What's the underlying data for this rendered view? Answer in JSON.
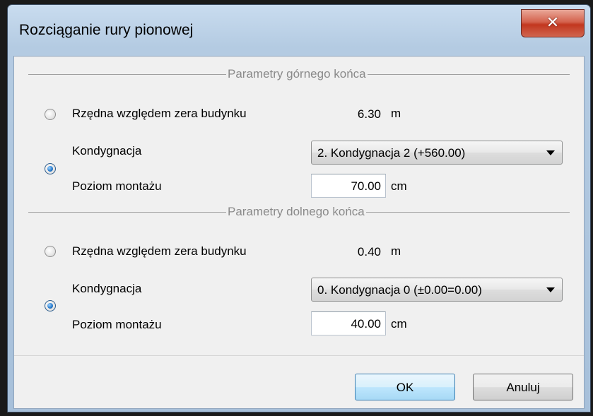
{
  "window": {
    "title": "Rozciąganie rury pionowej",
    "close_glyph": "✕"
  },
  "top_section": {
    "label": "Parametry górnego końca",
    "option_elevation": {
      "label": "Rzędna względem zera budynku",
      "value": "6.30",
      "unit": "m",
      "selected": false
    },
    "option_storey": {
      "label": "Kondygnacja",
      "selected": true,
      "storey_value": "2. Kondygnacja 2 (+560.00)",
      "mount_label": "Poziom montażu",
      "mount_value": "70.00",
      "mount_unit": "cm"
    }
  },
  "bottom_section": {
    "label": "Parametry dolnego końca",
    "option_elevation": {
      "label": "Rzędna względem zera budynku",
      "value": "0.40",
      "unit": "m",
      "selected": false
    },
    "option_storey": {
      "label": "Kondygnacja",
      "selected": true,
      "storey_value": "0. Kondygnacja 0 (±0.00=0.00)",
      "mount_label": "Poziom montażu",
      "mount_value": "40.00",
      "mount_unit": "cm"
    }
  },
  "buttons": {
    "ok": "OK",
    "cancel": "Anuluj"
  }
}
